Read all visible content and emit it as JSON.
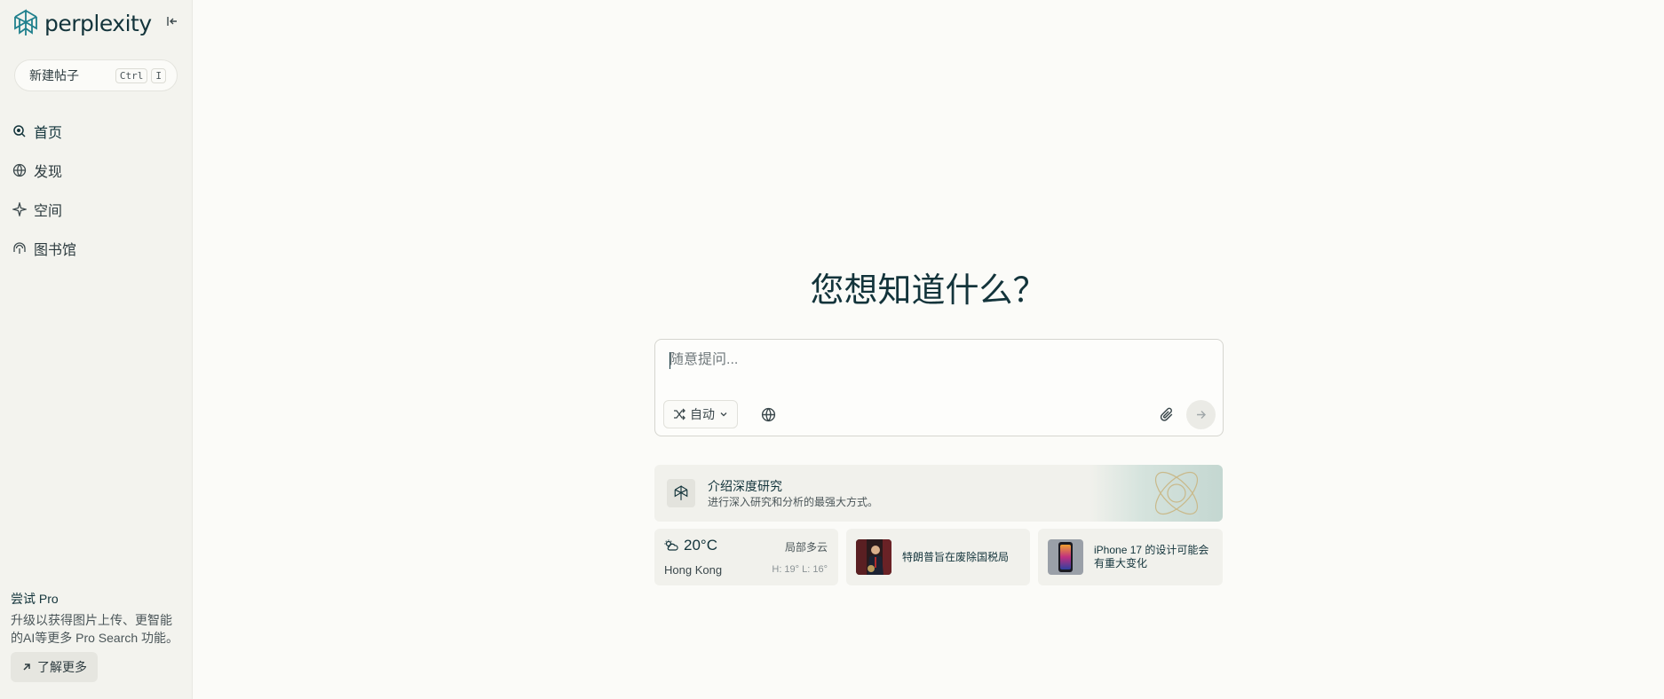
{
  "brand": {
    "name": "perplexity"
  },
  "sidebar": {
    "new_thread": {
      "label": "新建帖子",
      "key1": "Ctrl",
      "key2": "I"
    },
    "items": [
      {
        "label": "首页",
        "icon": "search-icon"
      },
      {
        "label": "发现",
        "icon": "globe-icon"
      },
      {
        "label": "空间",
        "icon": "sparkle-icon"
      },
      {
        "label": "图书馆",
        "icon": "library-icon"
      }
    ],
    "pro": {
      "title": "尝试 Pro",
      "desc": "升级以获得图片上传、更智能的AI等更多 Pro Search 功能。",
      "button": "了解更多"
    }
  },
  "main": {
    "headline": "您想知道什么？",
    "ask": {
      "placeholder": "随意提问...",
      "mode": "自动"
    },
    "research": {
      "title": "介绍深度研究",
      "subtitle": "进行深入研究和分析的最强大方式。"
    },
    "weather": {
      "temp": "20°C",
      "condition": "局部多云",
      "city": "Hong Kong",
      "hl": "H: 19° L: 16°"
    },
    "news": [
      {
        "title": "特朗普旨在废除国税局"
      },
      {
        "title": "iPhone 17 的设计可能会有重大变化"
      }
    ]
  },
  "colors": {
    "accent": "#13343b",
    "teal": "#20808d",
    "sidebar_bg": "#f3f3ee",
    "page_bg": "#fbfbf8"
  }
}
